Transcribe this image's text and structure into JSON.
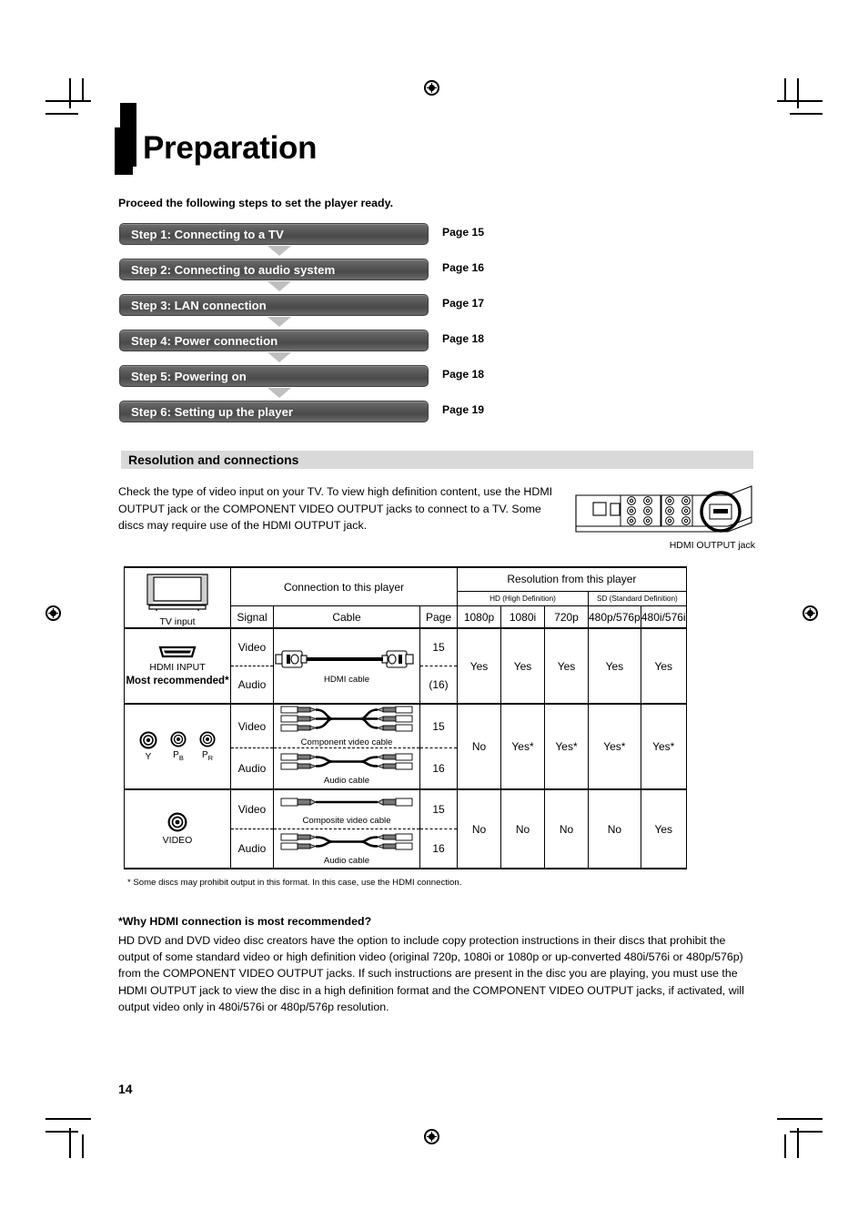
{
  "document": {
    "title": "Preparation",
    "intro": "Proceed the following steps to set the player ready.",
    "page_number": "14"
  },
  "steps": [
    {
      "label": "Step 1: Connecting to a TV",
      "page": "Page 15"
    },
    {
      "label": "Step 2: Connecting to audio system",
      "page": "Page 16"
    },
    {
      "label": "Step 3: LAN connection",
      "page": "Page 17"
    },
    {
      "label": "Step 4: Power connection",
      "page": "Page 18"
    },
    {
      "label": "Step 5: Powering on",
      "page": "Page 18"
    },
    {
      "label": "Step 6: Setting up the player",
      "page": "Page 19"
    }
  ],
  "section": {
    "heading": "Resolution and connections",
    "body": "Check the type of video input on your TV. To view high definition content, use the HDMI OUTPUT jack or the COMPONENT VIDEO OUTPUT jacks to connect to a TV. Some discs may require use of the HDMI OUTPUT jack.",
    "figure_caption": "HDMI OUTPUT jack"
  },
  "table": {
    "input_header": "TV input",
    "group_connection": "Connection to this player",
    "group_resolution": "Resolution from this player",
    "hd_group": "HD (High Definition)",
    "sd_group": "SD (Standard Definition)",
    "col_signal": "Signal",
    "col_cable": "Cable",
    "col_page": "Page",
    "res_columns": [
      "1080p",
      "1080i",
      "720p",
      "480p/576p",
      "480i/576i"
    ],
    "rows": [
      {
        "input_label": "HDMI INPUT",
        "input_note": "Most recommended*",
        "input_icon": "hdmi-port-icon",
        "video": {
          "signal": "Video",
          "cable": "HDMI cable",
          "cable_icon": "hdmi-cable-icon",
          "page": "15"
        },
        "audio": {
          "signal": "Audio",
          "cable": "",
          "cable_icon": "",
          "page": "(16)"
        },
        "resolutions": [
          "Yes",
          "Yes",
          "Yes",
          "Yes",
          "Yes"
        ]
      },
      {
        "input_label": "",
        "input_note": "",
        "input_icon": "component-jacks-icon",
        "jacks": [
          "Y",
          "PB",
          "PR"
        ],
        "video": {
          "signal": "Video",
          "cable": "Component video cable",
          "cable_icon": "component-cable-icon",
          "page": "15"
        },
        "audio": {
          "signal": "Audio",
          "cable": "Audio cable",
          "cable_icon": "audio-cable-icon",
          "page": "16"
        },
        "resolutions": [
          "No",
          "Yes*",
          "Yes*",
          "Yes*",
          "Yes*"
        ]
      },
      {
        "input_label": "VIDEO",
        "input_note": "",
        "input_icon": "rca-jack-icon",
        "video": {
          "signal": "Video",
          "cable": "Composite video cable",
          "cable_icon": "composite-cable-icon",
          "page": "15"
        },
        "audio": {
          "signal": "Audio",
          "cable": "Audio cable",
          "cable_icon": "audio-cable-icon",
          "page": "16"
        },
        "resolutions": [
          "No",
          "No",
          "No",
          "No",
          "Yes"
        ]
      }
    ],
    "footnote": "* Some discs may prohibit output in this format. In this case, use the HDMI connection."
  },
  "faq": {
    "question": "*Why HDMI connection is most recommended?",
    "answer": "HD DVD and DVD video disc creators have the option to include copy protection instructions in their discs that prohibit the output of some standard video or high definition video (original 720p, 1080i or 1080p or up-converted 480i/576i or 480p/576p) from the COMPONENT VIDEO OUTPUT jacks. If such instructions are present in the disc you are playing, you must use the HDMI OUTPUT jack to view the disc in a high definition format and the COMPONENT VIDEO OUTPUT jacks, if activated, will output video only in 480i/576i or 480p/576p resolution."
  }
}
